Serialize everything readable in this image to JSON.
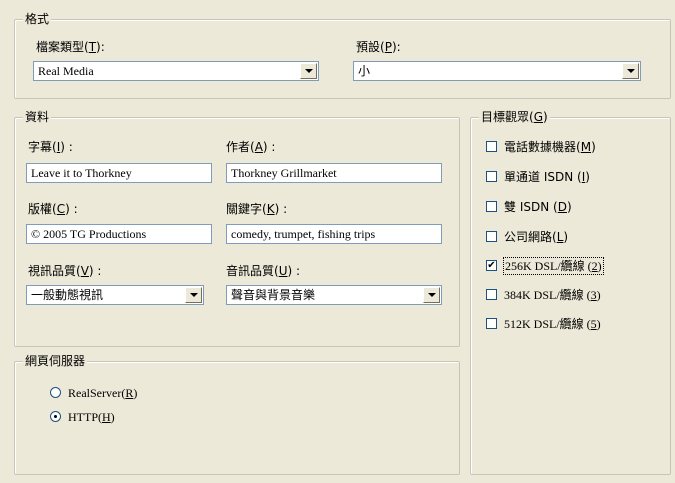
{
  "format_group": {
    "title": "格式",
    "file_type": {
      "label": "檔案類型",
      "key": "T",
      "value": "Real Media"
    },
    "preset": {
      "label": "預設",
      "key": "P",
      "value": "小"
    }
  },
  "data_group": {
    "title": "資料",
    "caption": {
      "label": "字幕",
      "key": "I",
      "value": "Leave it to Thorkney"
    },
    "author": {
      "label": "作者",
      "key": "A",
      "value": "Thorkney Grillmarket"
    },
    "copyright": {
      "label": "版權",
      "key": "C",
      "value": "© 2005 TG Productions"
    },
    "keywords": {
      "label": "關鍵字",
      "key": "K",
      "value": "comedy, trumpet, fishing trips"
    },
    "video_quality": {
      "label": "視訊品質",
      "key": "V",
      "value": "一般動態視訊"
    },
    "audio_quality": {
      "label": "音訊品質",
      "key": "U",
      "value": "聲音與背景音樂"
    }
  },
  "web_server_group": {
    "title": "網頁伺服器",
    "options": [
      {
        "label": "RealServer",
        "key": "R",
        "selected": false
      },
      {
        "label": "HTTP",
        "key": "H",
        "selected": true
      }
    ]
  },
  "audience_group": {
    "title": "目標觀眾",
    "key": "G",
    "items": [
      {
        "label": "電話數據機器",
        "key": "M",
        "checked": false
      },
      {
        "label": "單通道 ISDN",
        "key": "I",
        "checked": false
      },
      {
        "label": "雙 ISDN",
        "key": "D",
        "checked": false
      },
      {
        "label": "公司網路",
        "key": "L",
        "checked": false
      },
      {
        "label": "256K DSL/纜線",
        "key": "2",
        "checked": true
      },
      {
        "label": "384K DSL/纜線",
        "key": "3",
        "checked": false
      },
      {
        "label": "512K DSL/纜線",
        "key": "5",
        "checked": false
      }
    ]
  },
  "glyphs": {
    "check": "✔"
  }
}
